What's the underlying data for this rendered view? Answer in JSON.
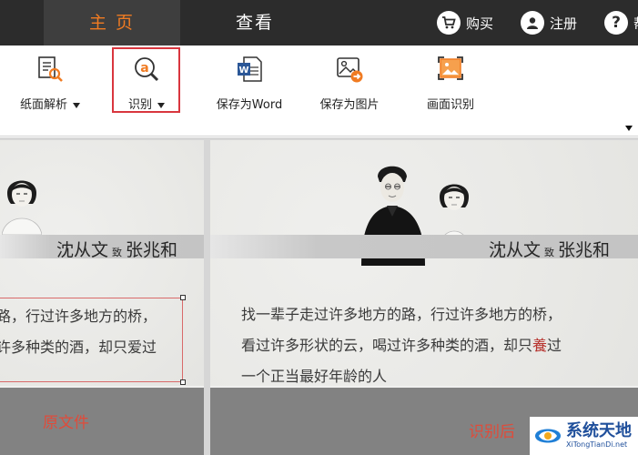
{
  "nav": {
    "tabs": [
      {
        "label": "主 页",
        "active": true
      },
      {
        "label": "查看",
        "active": false
      }
    ],
    "actions": [
      {
        "label": "购买",
        "icon": "cart-icon"
      },
      {
        "label": "注册",
        "icon": "user-icon"
      },
      {
        "label": "",
        "icon": "help-icon"
      }
    ],
    "help_partial_label": "帮"
  },
  "ribbon": {
    "items": [
      {
        "label": "纸面解析",
        "icon": "document-scan-icon",
        "dropdown": true
      },
      {
        "label": "识别",
        "icon": "ocr-recognize-icon",
        "dropdown": true,
        "highlighted": true
      },
      {
        "label": "保存为Word",
        "icon": "word-document-icon",
        "dropdown": false
      },
      {
        "label": "保存为图片",
        "icon": "save-image-icon",
        "dropdown": false
      },
      {
        "label": "画面识别",
        "icon": "screen-capture-icon",
        "dropdown": false
      }
    ]
  },
  "original": {
    "signature_left": "沈从文",
    "signature_mid": "致",
    "signature_right": "张兆和",
    "line1": "路，行过许多地方的桥，",
    "line2": "许多种类的酒，却只爱过",
    "caption": "原文件"
  },
  "result": {
    "signature_left": "沈从文",
    "signature_mid": "致",
    "signature_right": "张兆和",
    "line1": "找一辈子走过许多地方的路，行过许多地方的桥，",
    "line2_a": "看过许多形状的云，喝过许多种类的酒，却只",
    "line2_red": "養",
    "line2_b": "过",
    "line3": "一个正当最好年龄的人",
    "caption": "识别后"
  },
  "watermark": {
    "title": "系统天地",
    "url": "XiTongTianDi.net"
  },
  "colors": {
    "accent": "#f07b22",
    "nav_bg": "#2c2c2c",
    "highlight_border": "#d9363e",
    "caption_red": "#e04b3a"
  }
}
